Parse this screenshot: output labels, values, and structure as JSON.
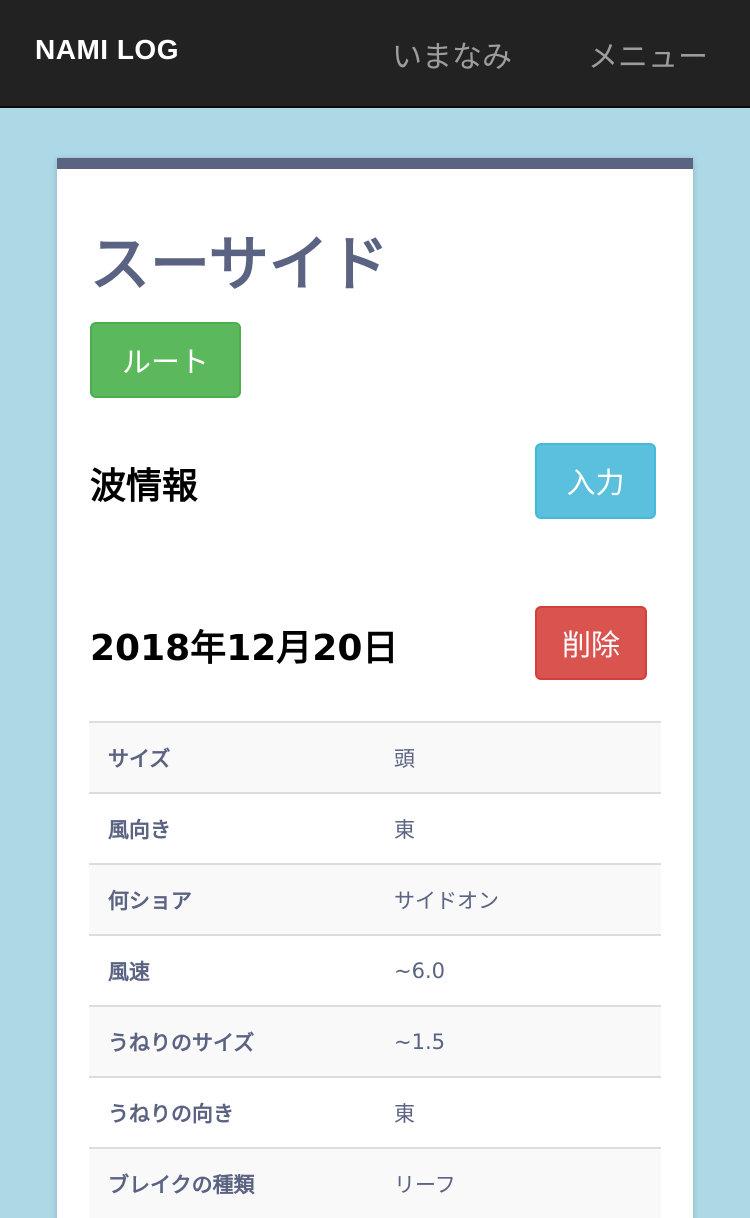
{
  "navbar": {
    "brand": "NAMI LOG",
    "links": [
      "いまなみ",
      "メニュー"
    ]
  },
  "spot": {
    "name": "スーサイド",
    "route_button": "ルート"
  },
  "wave_info": {
    "heading": "波情報",
    "input_button": "入力"
  },
  "entry": {
    "date": "2018年12月20日",
    "delete_button": "削除",
    "rows": [
      {
        "label": "サイズ",
        "value": "頭"
      },
      {
        "label": "風向き",
        "value": "東"
      },
      {
        "label": "何ショア",
        "value": "サイドオン"
      },
      {
        "label": "風速",
        "value": "~6.0"
      },
      {
        "label": "うねりのサイズ",
        "value": "~1.5"
      },
      {
        "label": "うねりの向き",
        "value": "東"
      },
      {
        "label": "ブレイクの種類",
        "value": "リーフ"
      }
    ]
  },
  "colors": {
    "navbar_bg": "#222222",
    "page_bg": "#add8e6",
    "accent": "#5a6382",
    "success": "#5cb85c",
    "info": "#5bc0de",
    "danger": "#d9534f"
  }
}
